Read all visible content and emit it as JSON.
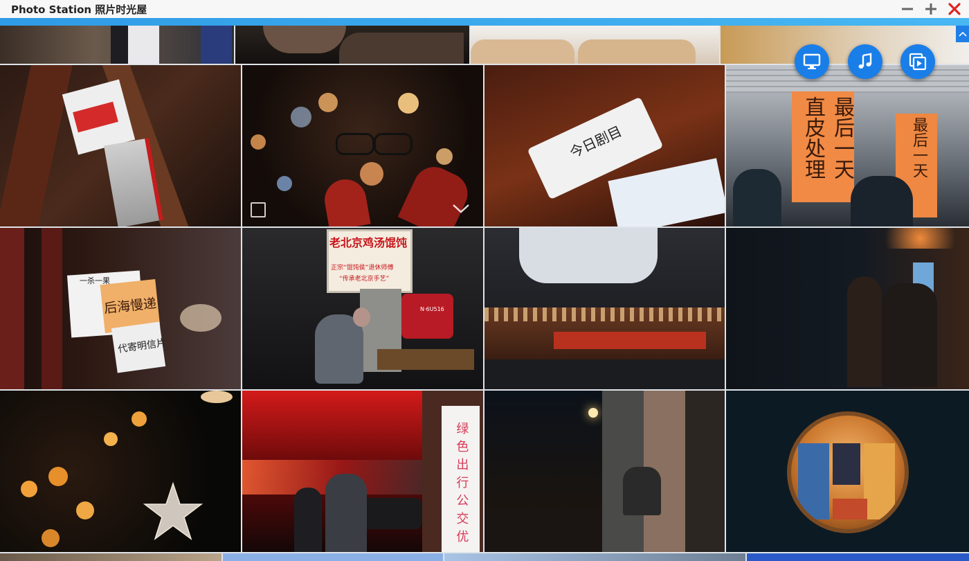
{
  "window": {
    "title": "Photo Station 照片时光屋"
  },
  "controls": {
    "minimize_icon": "minus-icon",
    "maximize_icon": "plus-icon",
    "close_icon": "close-x-icon",
    "close_color": "#e02424"
  },
  "floating_actions": [
    {
      "name": "slideshow-button",
      "icon": "monitor-icon"
    },
    {
      "name": "music-button",
      "icon": "music-note-icon"
    },
    {
      "name": "play-slideshow-button",
      "icon": "slides-play-icon"
    }
  ],
  "accent_color": "#2f9be6",
  "photos": {
    "menu_sign": "今日剧目",
    "right_sign_a": "最后一天",
    "right_sign_b": "直皮处理",
    "right_sign_c": "最后一天",
    "postcard_label": "后海慢递",
    "postcard_sub": "代寄明信片",
    "postcard_top": "一杀一果",
    "restaurant_sign": "老北京鸡汤馄饨",
    "restaurant_sub1": "正宗“馄饨侯”退休师傅",
    "restaurant_sub2": "“传承老北京手艺”",
    "plate": "N·6U516",
    "green_travel": "绿色出行公交优"
  }
}
